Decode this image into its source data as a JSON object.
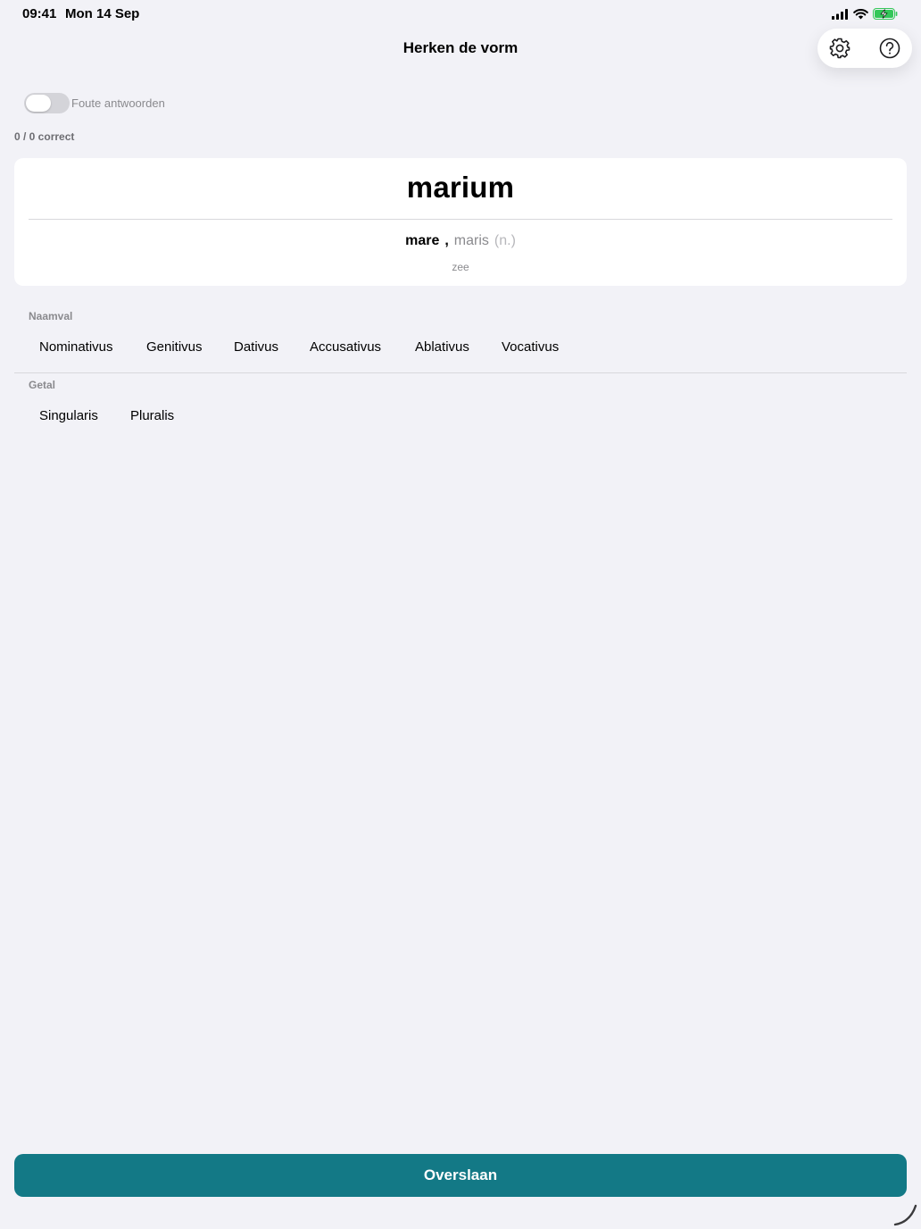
{
  "status_bar": {
    "time": "09:41",
    "date": "Mon 14 Sep",
    "battery_color": "#34c759"
  },
  "nav": {
    "title": "Herken de vorm",
    "settings_icon": "gear-icon",
    "help_icon": "question-circle-icon"
  },
  "toggle": {
    "label": "Foute antwoorden",
    "on": false
  },
  "score": "0 / 0 correct",
  "word": {
    "form": "marium",
    "lemma": "mare",
    "separator": ",",
    "genitive": "maris",
    "gender": "(n.)",
    "translation": "zee"
  },
  "cases": {
    "label": "Naamval",
    "options": [
      "Nominativus",
      "Genitivus",
      "Dativus",
      "Accusativus",
      "Ablativus",
      "Vocativus"
    ]
  },
  "number": {
    "label": "Getal",
    "options": [
      "Singularis",
      "Pluralis"
    ]
  },
  "skip_button": {
    "label": "Overslaan",
    "color": "#137986"
  }
}
